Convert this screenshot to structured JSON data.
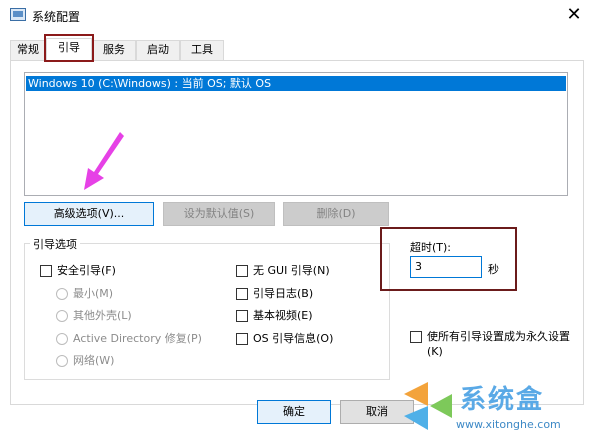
{
  "window": {
    "title": "系统配置"
  },
  "tabs": [
    {
      "label": "常规"
    },
    {
      "label": "引导"
    },
    {
      "label": "服务"
    },
    {
      "label": "启动"
    },
    {
      "label": "工具"
    }
  ],
  "os_list": [
    "Windows 10 (C:\\Windows) : 当前 OS; 默认 OS"
  ],
  "buttons": {
    "advanced": "高级选项(V)...",
    "set_default": "设为默认值(S)",
    "delete": "删除(D)",
    "ok": "确定",
    "cancel": "取消"
  },
  "boot_options": {
    "title": "引导选项",
    "safe_boot": "安全引导(F)",
    "minimal": "最小(M)",
    "alternate_shell": "其他外壳(L)",
    "active_directory": "Active Directory 修复(P)",
    "network": "网络(W)",
    "no_gui": "无 GUI 引导(N)",
    "boot_log": "引导日志(B)",
    "base_video": "基本视频(E)",
    "os_info": "OS 引导信息(O)"
  },
  "timeout": {
    "label": "超时(T):",
    "value": "3",
    "unit": "秒"
  },
  "permanent": {
    "label": "使所有引导设置成为永久设置(K)"
  },
  "watermark": {
    "name": "系统盒",
    "url": "www.xitonghe.com"
  },
  "colors": {
    "selection": "#0078d7",
    "highlight_box": "#8b1a1a",
    "arrow": "#e641e6"
  }
}
